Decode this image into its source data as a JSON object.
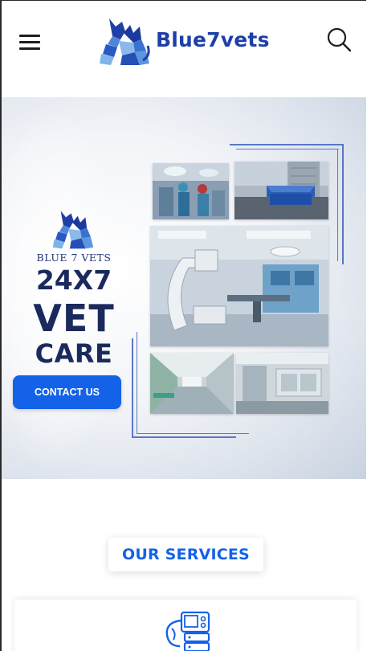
{
  "header": {
    "brand": "Blue7vets",
    "menu_icon": "hamburger-menu-icon",
    "search_icon": "search-icon",
    "brand_color": "#1f3fa8"
  },
  "hero": {
    "brand": "BLUE 7 VETS",
    "headline_line1": "24X7",
    "headline_line2": "VET",
    "headline_line3": "CARE",
    "cta_label": "CONTACT US",
    "cta_color": "#1462e8",
    "text_color": "#1b2a5c",
    "photos": [
      "operating-room-photo",
      "hospital-building-photo",
      "c-arm-surgery-room-photo",
      "corridor-photo",
      "clinic-room-photo"
    ]
  },
  "services": {
    "title": "OUR SERVICES",
    "first_card_icon": "endoscopy-machine-icon"
  }
}
